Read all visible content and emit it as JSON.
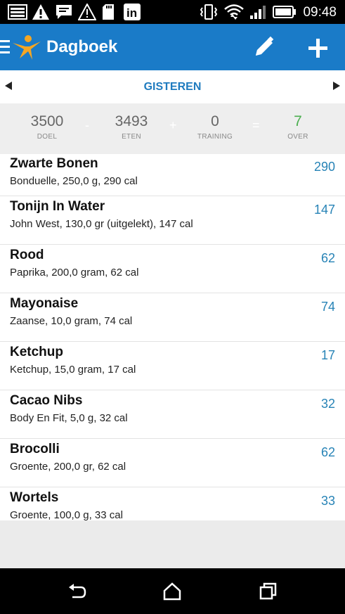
{
  "status_bar": {
    "time": "09:48",
    "icons": [
      "gallery-icon",
      "warning-icon",
      "message-icon",
      "warning-icon",
      "sdcard-icon",
      "linkedin-icon",
      "vibrate-icon",
      "wifi-icon",
      "signal-icon",
      "battery-icon"
    ],
    "linkedin_text": "in"
  },
  "action_bar": {
    "title": "Dagboek",
    "color": "#1a7bc8",
    "actions": [
      "edit-icon",
      "add-icon"
    ]
  },
  "date_bar": {
    "label": "GISTEREN"
  },
  "summary": {
    "goal": {
      "value": "3500",
      "label": "DOEL"
    },
    "food": {
      "value": "3493",
      "label": "ETEN"
    },
    "exercise": {
      "value": "0",
      "label": "TRAINING"
    },
    "remaining": {
      "value": "7",
      "label": "OVER",
      "color": "#4caf50"
    },
    "op_minus": "-",
    "op_plus": "+",
    "op_equals": "="
  },
  "entries": [
    {
      "name": "Zwarte Bonen",
      "desc": "Bonduelle, 250,0 g, 290 cal",
      "cal": "290"
    },
    {
      "name": "Tonijn In Water",
      "desc": "John West, 130,0 gr (uitgelekt), 147 cal",
      "cal": "147"
    },
    {
      "name": "Rood",
      "desc": "Paprika, 200,0 gram, 62 cal",
      "cal": "62"
    },
    {
      "name": "Mayonaise",
      "desc": "Zaanse, 10,0 gram, 74 cal",
      "cal": "74"
    },
    {
      "name": "Ketchup",
      "desc": "Ketchup, 15,0 gram, 17 cal",
      "cal": "17"
    },
    {
      "name": "Cacao Nibs",
      "desc": "Body En Fit, 5,0 g, 32 cal",
      "cal": "32"
    },
    {
      "name": "Brocolli",
      "desc": "Groente, 200,0 gr, 62 cal",
      "cal": "62"
    },
    {
      "name": "Wortels",
      "desc": "Groente, 100,0 g, 33 cal",
      "cal": "33"
    }
  ],
  "nav_bar": [
    "back-icon",
    "home-icon",
    "recents-icon"
  ]
}
